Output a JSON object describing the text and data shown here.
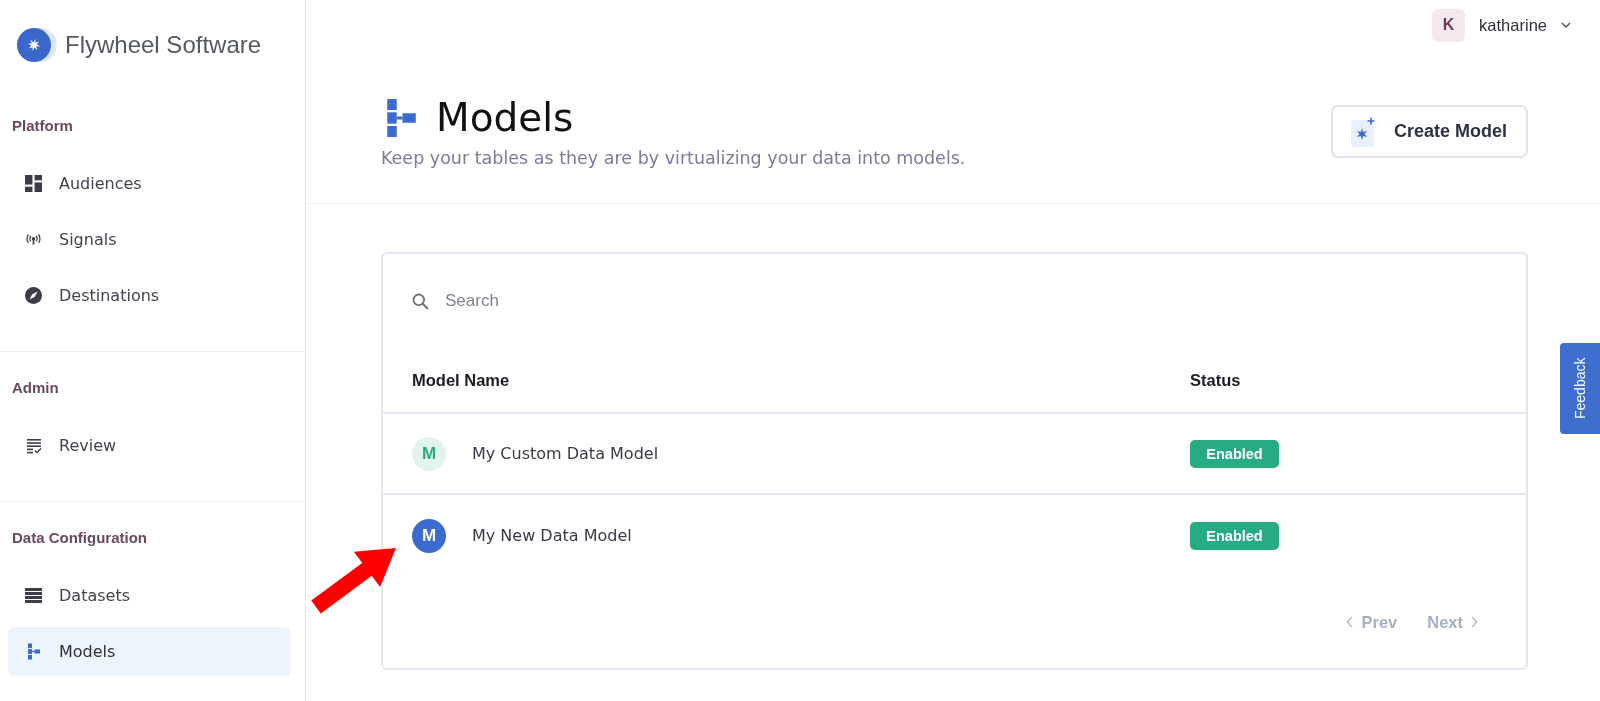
{
  "sidebar": {
    "brand": "Flywheel Software",
    "sections": [
      {
        "title": "Platform",
        "items": [
          {
            "label": "Audiences",
            "selected": false
          },
          {
            "label": "Signals",
            "selected": false
          },
          {
            "label": "Destinations",
            "selected": false
          }
        ]
      },
      {
        "title": "Admin",
        "items": [
          {
            "label": "Review",
            "selected": false
          }
        ]
      },
      {
        "title": "Data Configuration",
        "items": [
          {
            "label": "Datasets",
            "selected": false
          },
          {
            "label": "Models",
            "selected": true
          }
        ]
      }
    ]
  },
  "user_menu": {
    "avatar": "K",
    "name": "katharine"
  },
  "header": {
    "title": "Models",
    "subtitle": "Keep your tables as they are by virtualizing your data into models.",
    "create_button": "Create Model"
  },
  "table": {
    "search": {
      "placeholder": "Search"
    },
    "columns": [
      "Model Name",
      "Status"
    ],
    "rows": [
      {
        "avatar": "M",
        "kind": "soft",
        "color": "#27ab83",
        "name": "My Custom Data Model",
        "status": "Enabled"
      },
      {
        "avatar": "M",
        "kind": "solid",
        "color": "#3b6bd0",
        "name": "My New Data Model",
        "status": "Enabled"
      }
    ],
    "pagination": [
      {
        "kind": "prev",
        "label": "Prev",
        "disabled": true
      },
      {
        "kind": "next",
        "label": "Next",
        "disabled": true
      }
    ]
  },
  "feedback_tab": "Feedback"
}
